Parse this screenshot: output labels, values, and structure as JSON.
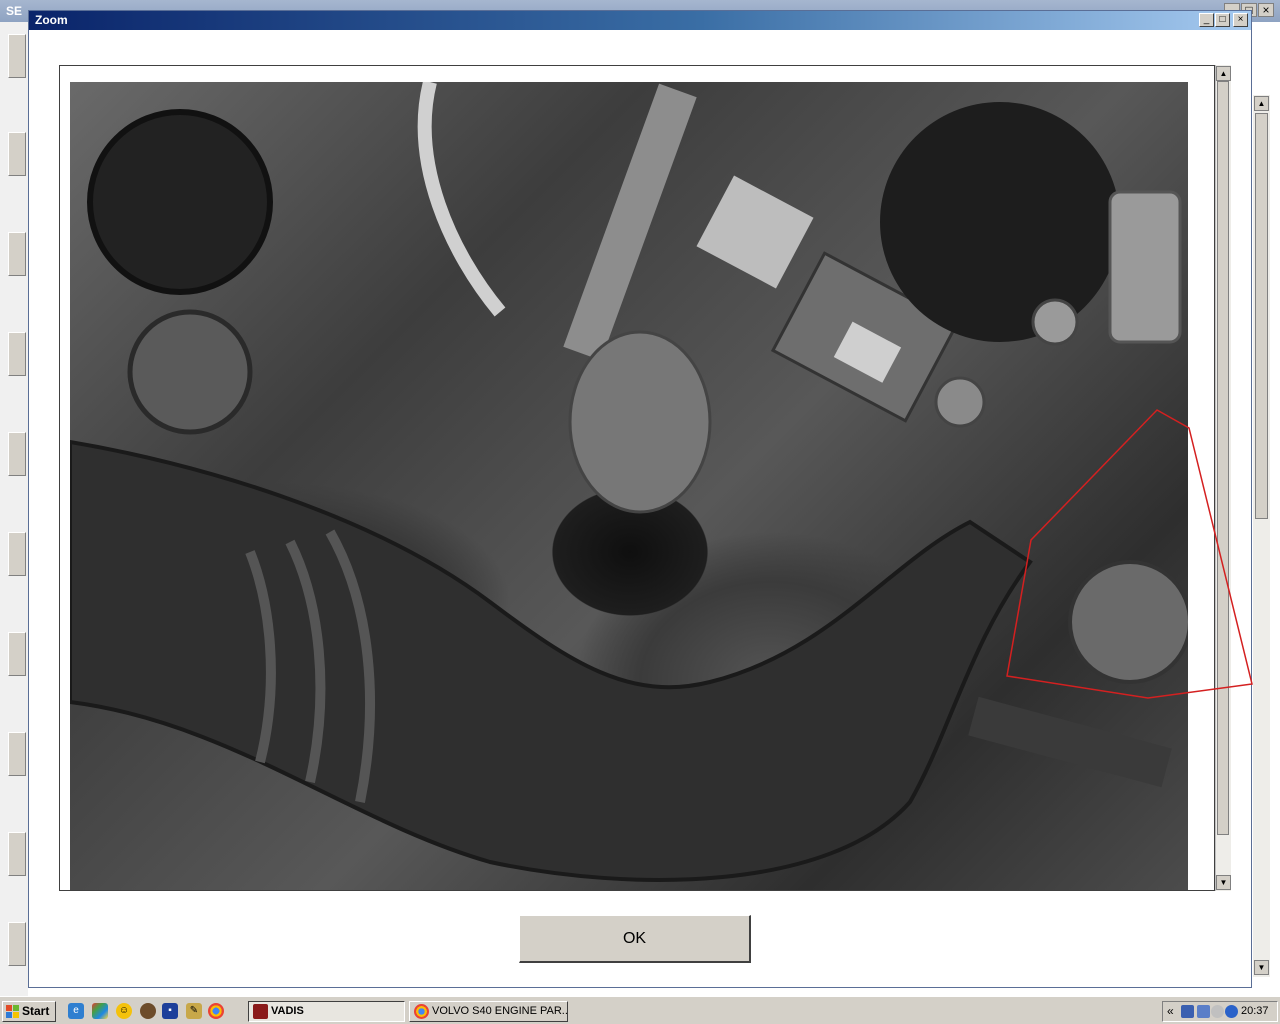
{
  "background_window": {
    "title": "SE",
    "controls": [
      "_",
      "□",
      "×"
    ]
  },
  "dialog": {
    "title": "Zoom",
    "controls": {
      "minimize": "_",
      "maximize": "□",
      "close": "×"
    },
    "image_description": "Engine bay photo (grayscale)",
    "ok_label": "OK",
    "highlight_color": "#d42020"
  },
  "scrollbar": {
    "up": "▲",
    "down": "▼"
  },
  "taskbar": {
    "start_label": "Start",
    "quick_launch": [
      "ie-icon",
      "picasa-icon",
      "messenger-icon",
      "media-icon",
      "save-icon",
      "tool-icon",
      "chrome-icon"
    ],
    "tasks": [
      {
        "label": "VADIS",
        "active": true
      },
      {
        "label": "VOLVO S40 ENGINE PAR...",
        "active": false
      }
    ],
    "tray_expand": "«",
    "clock": "20:37"
  }
}
